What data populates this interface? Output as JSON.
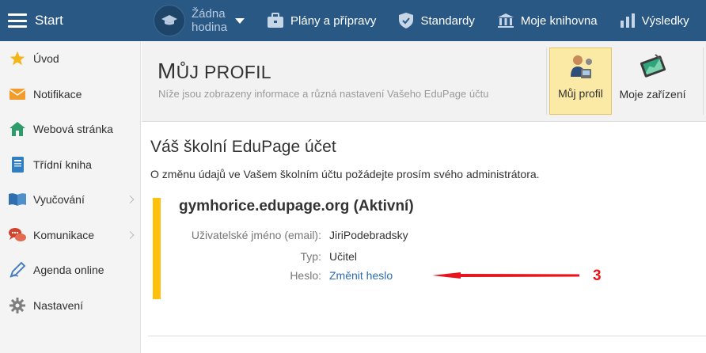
{
  "topbar": {
    "start_label": "Start",
    "lesson_line1": "Žádna",
    "lesson_line2": "hodina",
    "menu": [
      {
        "label": "Plány a přípravy",
        "icon": "briefcase-icon"
      },
      {
        "label": "Standardy",
        "icon": "shield-check-icon"
      },
      {
        "label": "Moje knihovna",
        "icon": "library-icon"
      },
      {
        "label": "Výsledky",
        "icon": "bar-chart-icon"
      }
    ]
  },
  "sidebar": {
    "items": [
      {
        "label": "Úvod",
        "icon": "star-icon",
        "color": "#f3b51a",
        "submenu": false
      },
      {
        "label": "Notifikace",
        "icon": "envelope-icon",
        "color": "#f39c2b",
        "submenu": false
      },
      {
        "label": "Webová stránka",
        "icon": "home-icon",
        "color": "#2e9b6a",
        "submenu": false
      },
      {
        "label": "Třídní kniha",
        "icon": "notebook-icon",
        "color": "#2f7fc2",
        "submenu": false
      },
      {
        "label": "Vyučování",
        "icon": "open-book-icon",
        "color": "#2f6fb0",
        "submenu": true
      },
      {
        "label": "Komunikace",
        "icon": "chat-icon",
        "color": "#d2412c",
        "submenu": true
      },
      {
        "label": "Agenda online",
        "icon": "pen-icon",
        "color": "#4a7fc0",
        "submenu": false
      },
      {
        "label": "Nastavení",
        "icon": "gear-icon",
        "color": "#7f7f7f",
        "submenu": false
      }
    ]
  },
  "header": {
    "title_cap": "M",
    "title_rest": "ŮJ PROFIL",
    "subtitle": "Níže jsou zobrazeny informace a různá nastavení Vašeho EduPage účtu",
    "tiles": [
      {
        "label": "Můj profil",
        "active": true
      },
      {
        "label": "Moje zařízení",
        "active": false
      }
    ]
  },
  "content": {
    "heading": "Váš školní EduPage účet",
    "info": "O změnu údajů ve Vašem školním účtu požádejte prosím svého administrátora.",
    "account": {
      "domain": "gymhorice.edupage.org (Aktivní)",
      "rows": [
        {
          "label": "Uživatelské jméno (email):",
          "value": "JiriPodebradsky"
        },
        {
          "label": "Typ:",
          "value": "Učitel"
        },
        {
          "label": "Heslo:",
          "value": "Změnit heslo"
        }
      ]
    },
    "annotation": "3"
  },
  "colors": {
    "topbar": "#2a5885",
    "accent_bar": "#fec00f",
    "link": "#2a6db0",
    "annotation": "#e8141c",
    "active_tile": "#fbe9a6"
  }
}
